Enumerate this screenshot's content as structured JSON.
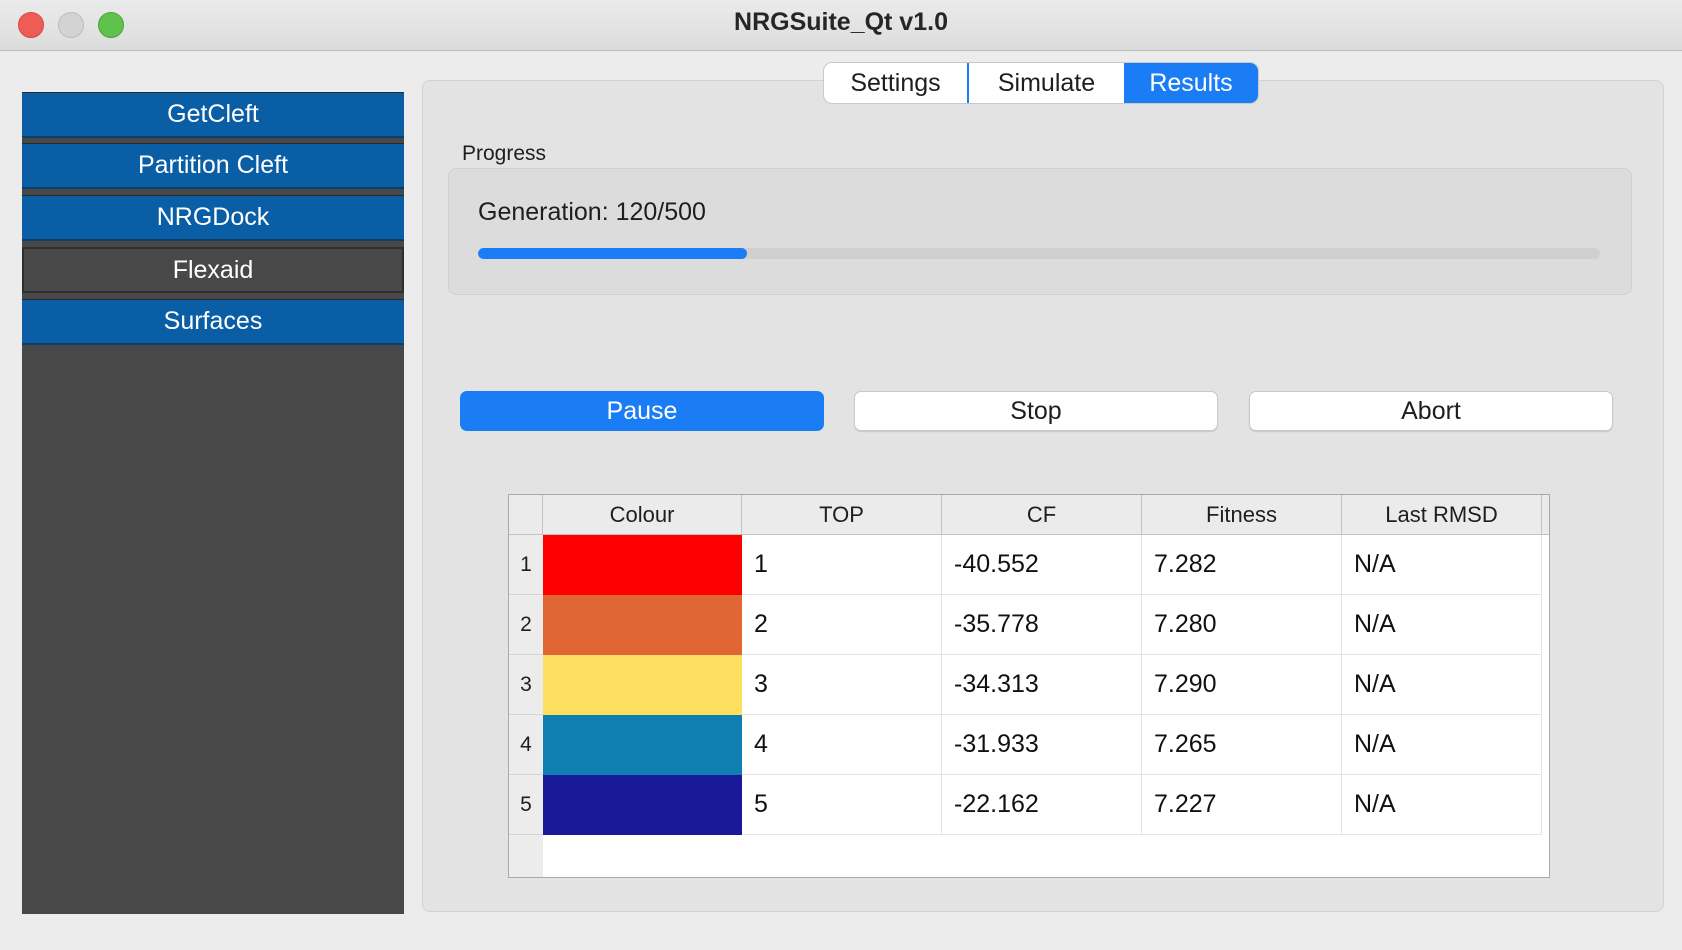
{
  "window": {
    "title": "NRGSuite_Qt v1.0"
  },
  "sidebar": {
    "items": [
      {
        "label": "GetCleft",
        "selected": false
      },
      {
        "label": "Partition Cleft",
        "selected": false
      },
      {
        "label": "NRGDock",
        "selected": false
      },
      {
        "label": "Flexaid",
        "selected": true
      },
      {
        "label": "Surfaces",
        "selected": false
      }
    ]
  },
  "tabs": [
    {
      "label": "Settings",
      "active": false
    },
    {
      "label": "Simulate",
      "active": false
    },
    {
      "label": "Results",
      "active": true
    }
  ],
  "progress": {
    "label": "Progress",
    "generation_text": "Generation: 120/500",
    "fraction": 0.24
  },
  "actions": {
    "pause_label": "Pause",
    "stop_label": "Stop",
    "abort_label": "Abort"
  },
  "table": {
    "columns": [
      "Colour",
      "TOP",
      "CF",
      "Fitness",
      "Last RMSD"
    ],
    "rows": [
      {
        "index": "1",
        "colour": "#ff0000",
        "top": "1",
        "cf": "-40.552",
        "fitness": "7.282",
        "rmsd": "N/A"
      },
      {
        "index": "2",
        "colour": "#e06633",
        "top": "2",
        "cf": "-35.778",
        "fitness": "7.280",
        "rmsd": "N/A"
      },
      {
        "index": "3",
        "colour": "#ffdf60",
        "top": "3",
        "cf": "-34.313",
        "fitness": "7.290",
        "rmsd": "N/A"
      },
      {
        "index": "4",
        "colour": "#0e7fb0",
        "top": "4",
        "cf": "-31.933",
        "fitness": "7.265",
        "rmsd": "N/A"
      },
      {
        "index": "5",
        "colour": "#1a1a99",
        "top": "5",
        "cf": "-22.162",
        "fitness": "7.227",
        "rmsd": "N/A"
      }
    ]
  }
}
